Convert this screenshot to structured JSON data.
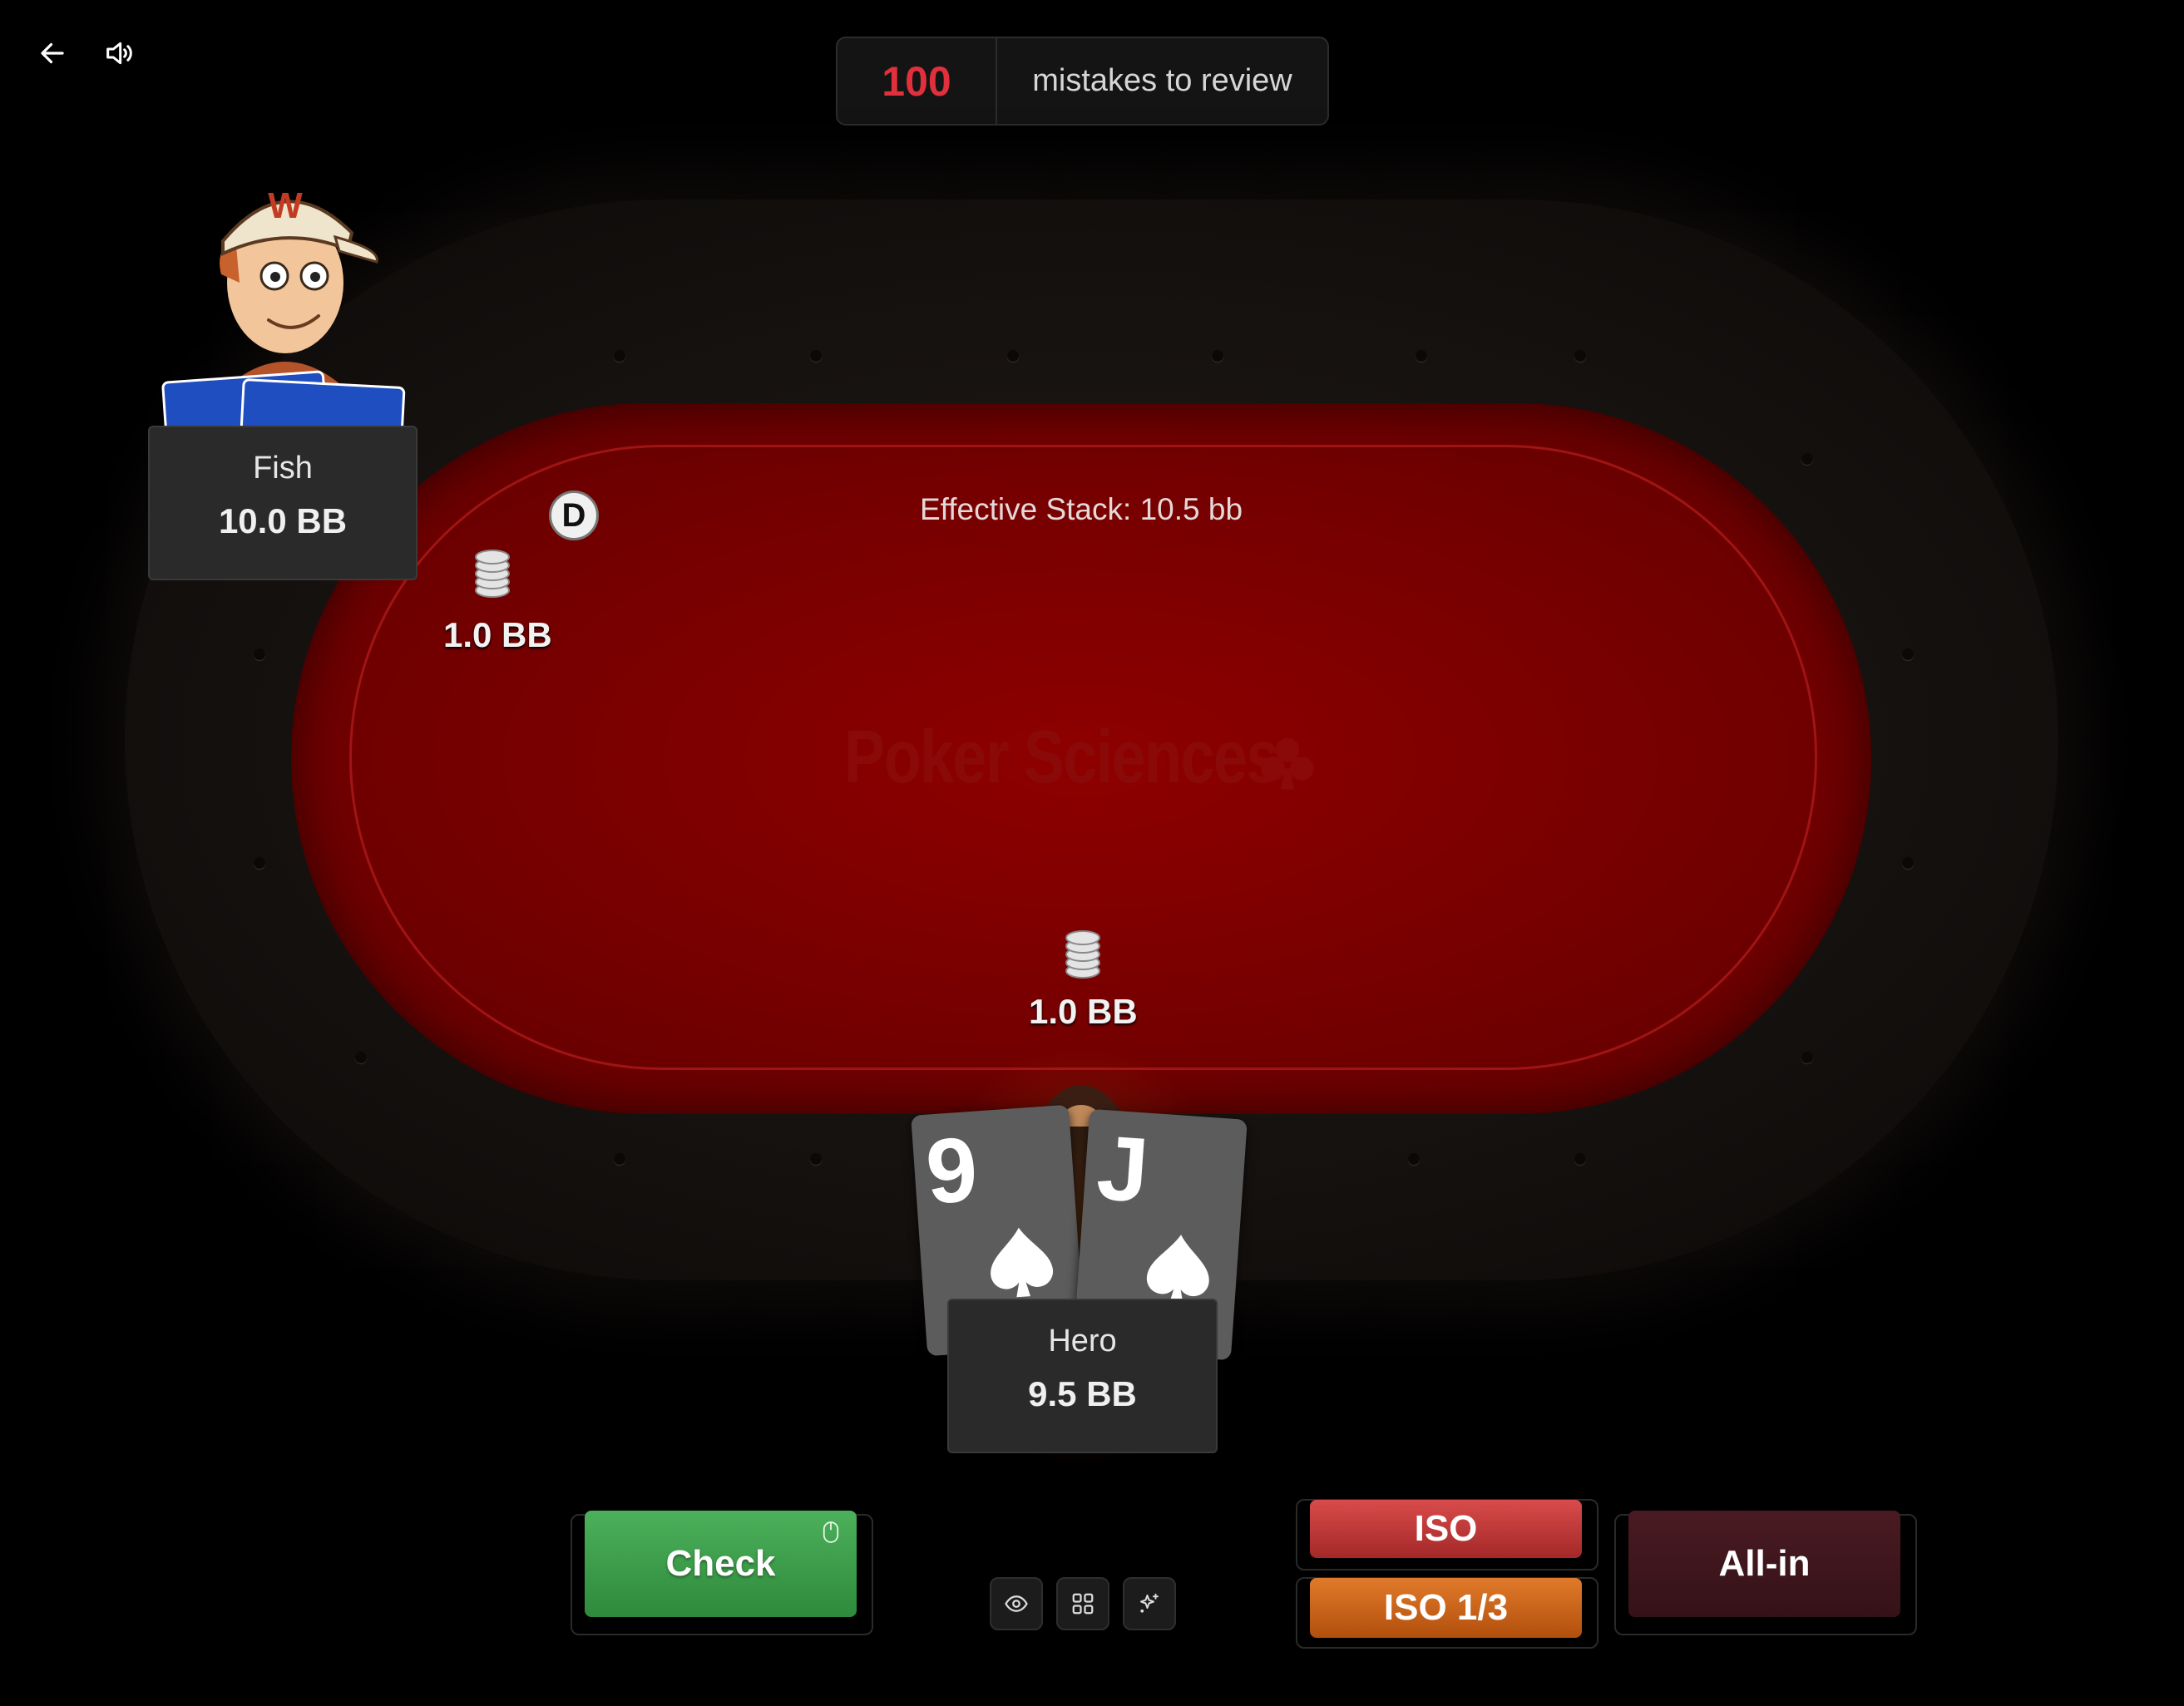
{
  "header": {
    "back_icon": "arrow-left-icon",
    "sound_icon": "speaker-icon",
    "mistakes_count": "100",
    "mistakes_label": "mistakes to review"
  },
  "table": {
    "effective_stack": "Effective Stack: 10.5 bb",
    "watermark": "Poker Sciences",
    "dealer_button": "D",
    "felt_color": "#8e0000"
  },
  "villain": {
    "name": "Fish",
    "stack": "10.0 BB",
    "bet": "1.0 BB"
  },
  "hero": {
    "name": "Hero",
    "stack": "9.5 BB",
    "bet": "1.0 BB",
    "cards": [
      {
        "rank": "9",
        "suit": "spade"
      },
      {
        "rank": "J",
        "suit": "spade"
      }
    ]
  },
  "actions": {
    "check": "Check",
    "iso": "ISO",
    "iso_third": "ISO 1/3",
    "allin": "All-in",
    "check_color": "#3a9c48",
    "iso_color": "#c43c3c",
    "iso_third_color": "#cc6418",
    "allin_color": "#40161d"
  },
  "toolbar": {
    "items": [
      "eye-icon",
      "grid-icon",
      "sparkle-icon"
    ]
  }
}
